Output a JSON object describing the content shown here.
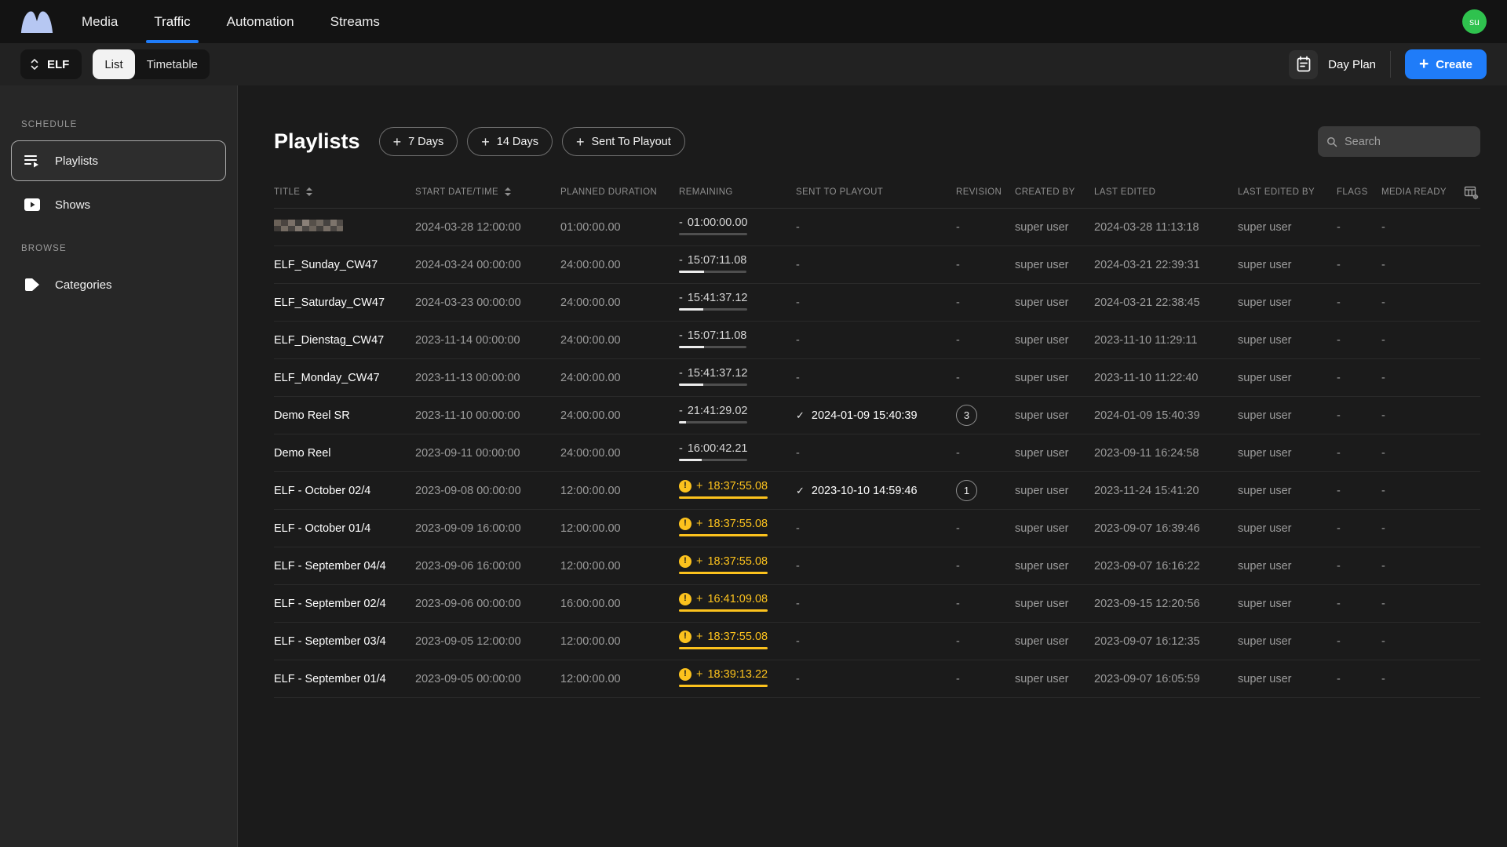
{
  "colors": {
    "accent": "#1f7cf9",
    "warning": "#fcc21d",
    "avatar_green": "#2fc24e"
  },
  "nav": {
    "tabs": [
      {
        "label": "Media",
        "active": false
      },
      {
        "label": "Traffic",
        "active": true
      },
      {
        "label": "Automation",
        "active": false
      },
      {
        "label": "Streams",
        "active": false
      }
    ],
    "avatar_initials": "su"
  },
  "toolbar": {
    "channel_selector": "ELF",
    "view_toggle": [
      {
        "label": "List",
        "active": true
      },
      {
        "label": "Timetable",
        "active": false
      }
    ],
    "day_plan_label": "Day Plan",
    "create_label": "Create"
  },
  "sidebar": {
    "sections": [
      {
        "label": "SCHEDULE",
        "items": [
          {
            "label": "Playlists",
            "icon": "playlists-icon",
            "active": true
          },
          {
            "label": "Shows",
            "icon": "shows-icon",
            "active": false
          }
        ]
      },
      {
        "label": "BROWSE",
        "items": [
          {
            "label": "Categories",
            "icon": "categories-icon",
            "active": false
          }
        ]
      }
    ]
  },
  "main": {
    "title": "Playlists",
    "action_buttons": [
      "7 Days",
      "14 Days",
      "Sent To Playout"
    ],
    "search_placeholder": "Search",
    "table": {
      "columns": [
        {
          "label": "TITLE",
          "sortable": true
        },
        {
          "label": "START DATE/TIME",
          "sortable": true
        },
        {
          "label": "PLANNED DURATION",
          "sortable": false
        },
        {
          "label": "REMAINING",
          "sortable": false
        },
        {
          "label": "SENT TO PLAYOUT",
          "sortable": false
        },
        {
          "label": "REVISION",
          "sortable": false
        },
        {
          "label": "CREATED BY",
          "sortable": false
        },
        {
          "label": "LAST EDITED",
          "sortable": false
        },
        {
          "label": "LAST EDITED BY",
          "sortable": false
        },
        {
          "label": "FLAGS",
          "sortable": false
        },
        {
          "label": "MEDIA READY",
          "sortable": false
        }
      ],
      "rows": [
        {
          "title": "",
          "redacted": true,
          "start": "2024-03-28 12:00:00",
          "planned": "01:00:00.00",
          "remaining": {
            "sign": "-",
            "value": "01:00:00.00",
            "warning": false,
            "progress_pct": 0
          },
          "sent_to_playout": "-",
          "revision": "-",
          "created_by": "super user",
          "last_edited": "2024-03-28 11:13:18",
          "last_edited_by": "super user",
          "flags": "-",
          "media_ready": "-"
        },
        {
          "title": "ELF_Sunday_CW47",
          "redacted": false,
          "start": "2024-03-24 00:00:00",
          "planned": "24:00:00.00",
          "remaining": {
            "sign": "-",
            "value": "15:07:11.08",
            "warning": false,
            "progress_pct": 37
          },
          "sent_to_playout": "-",
          "revision": "-",
          "created_by": "super user",
          "last_edited": "2024-03-21 22:39:31",
          "last_edited_by": "super user",
          "flags": "-",
          "media_ready": "-"
        },
        {
          "title": "ELF_Saturday_CW47",
          "redacted": false,
          "start": "2024-03-23 00:00:00",
          "planned": "24:00:00.00",
          "remaining": {
            "sign": "-",
            "value": "15:41:37.12",
            "warning": false,
            "progress_pct": 35
          },
          "sent_to_playout": "-",
          "revision": "-",
          "created_by": "super user",
          "last_edited": "2024-03-21 22:38:45",
          "last_edited_by": "super user",
          "flags": "-",
          "media_ready": "-"
        },
        {
          "title": "ELF_Dienstag_CW47",
          "redacted": false,
          "start": "2023-11-14 00:00:00",
          "planned": "24:00:00.00",
          "remaining": {
            "sign": "-",
            "value": "15:07:11.08",
            "warning": false,
            "progress_pct": 37
          },
          "sent_to_playout": "-",
          "revision": "-",
          "created_by": "super user",
          "last_edited": "2023-11-10 11:29:11",
          "last_edited_by": "super user",
          "flags": "-",
          "media_ready": "-"
        },
        {
          "title": "ELF_Monday_CW47",
          "redacted": false,
          "start": "2023-11-13 00:00:00",
          "planned": "24:00:00.00",
          "remaining": {
            "sign": "-",
            "value": "15:41:37.12",
            "warning": false,
            "progress_pct": 35
          },
          "sent_to_playout": "-",
          "revision": "-",
          "created_by": "super user",
          "last_edited": "2023-11-10 11:22:40",
          "last_edited_by": "super user",
          "flags": "-",
          "media_ready": "-"
        },
        {
          "title": "Demo Reel SR",
          "redacted": false,
          "start": "2023-11-10 00:00:00",
          "planned": "24:00:00.00",
          "remaining": {
            "sign": "-",
            "value": "21:41:29.02",
            "warning": false,
            "progress_pct": 10
          },
          "sent_to_playout": "2024-01-09 15:40:39",
          "revision": "3",
          "created_by": "super user",
          "last_edited": "2024-01-09 15:40:39",
          "last_edited_by": "super user",
          "flags": "-",
          "media_ready": "-"
        },
        {
          "title": "Demo Reel",
          "redacted": false,
          "start": "2023-09-11 00:00:00",
          "planned": "24:00:00.00",
          "remaining": {
            "sign": "-",
            "value": "16:00:42.21",
            "warning": false,
            "progress_pct": 33
          },
          "sent_to_playout": "-",
          "revision": "-",
          "created_by": "super user",
          "last_edited": "2023-09-11 16:24:58",
          "last_edited_by": "super user",
          "flags": "-",
          "media_ready": "-"
        },
        {
          "title": "ELF - October 02/4",
          "redacted": false,
          "start": "2023-09-08 00:00:00",
          "planned": "12:00:00.00",
          "remaining": {
            "sign": "+",
            "value": "18:37:55.08",
            "warning": true,
            "progress_pct": 100
          },
          "sent_to_playout": "2023-10-10 14:59:46",
          "revision": "1",
          "created_by": "super user",
          "last_edited": "2023-11-24 15:41:20",
          "last_edited_by": "super user",
          "flags": "-",
          "media_ready": "-"
        },
        {
          "title": "ELF - October 01/4",
          "redacted": false,
          "start": "2023-09-09 16:00:00",
          "planned": "12:00:00.00",
          "remaining": {
            "sign": "+",
            "value": "18:37:55.08",
            "warning": true,
            "progress_pct": 100
          },
          "sent_to_playout": "-",
          "revision": "-",
          "created_by": "super user",
          "last_edited": "2023-09-07 16:39:46",
          "last_edited_by": "super user",
          "flags": "-",
          "media_ready": "-"
        },
        {
          "title": "ELF - September 04/4",
          "redacted": false,
          "start": "2023-09-06 16:00:00",
          "planned": "12:00:00.00",
          "remaining": {
            "sign": "+",
            "value": "18:37:55.08",
            "warning": true,
            "progress_pct": 100
          },
          "sent_to_playout": "-",
          "revision": "-",
          "created_by": "super user",
          "last_edited": "2023-09-07 16:16:22",
          "last_edited_by": "super user",
          "flags": "-",
          "media_ready": "-"
        },
        {
          "title": "ELF - September 02/4",
          "redacted": false,
          "start": "2023-09-06 00:00:00",
          "planned": "16:00:00.00",
          "remaining": {
            "sign": "+",
            "value": "16:41:09.08",
            "warning": true,
            "progress_pct": 100
          },
          "sent_to_playout": "-",
          "revision": "-",
          "created_by": "super user",
          "last_edited": "2023-09-15 12:20:56",
          "last_edited_by": "super user",
          "flags": "-",
          "media_ready": "-"
        },
        {
          "title": "ELF - September 03/4",
          "redacted": false,
          "start": "2023-09-05 12:00:00",
          "planned": "12:00:00.00",
          "remaining": {
            "sign": "+",
            "value": "18:37:55.08",
            "warning": true,
            "progress_pct": 100
          },
          "sent_to_playout": "-",
          "revision": "-",
          "created_by": "super user",
          "last_edited": "2023-09-07 16:12:35",
          "last_edited_by": "super user",
          "flags": "-",
          "media_ready": "-"
        },
        {
          "title": "ELF - September 01/4",
          "redacted": false,
          "start": "2023-09-05 00:00:00",
          "planned": "12:00:00.00",
          "remaining": {
            "sign": "+",
            "value": "18:39:13.22",
            "warning": true,
            "progress_pct": 100
          },
          "sent_to_playout": "-",
          "revision": "-",
          "created_by": "super user",
          "last_edited": "2023-09-07 16:05:59",
          "last_edited_by": "super user",
          "flags": "-",
          "media_ready": "-"
        }
      ]
    }
  }
}
